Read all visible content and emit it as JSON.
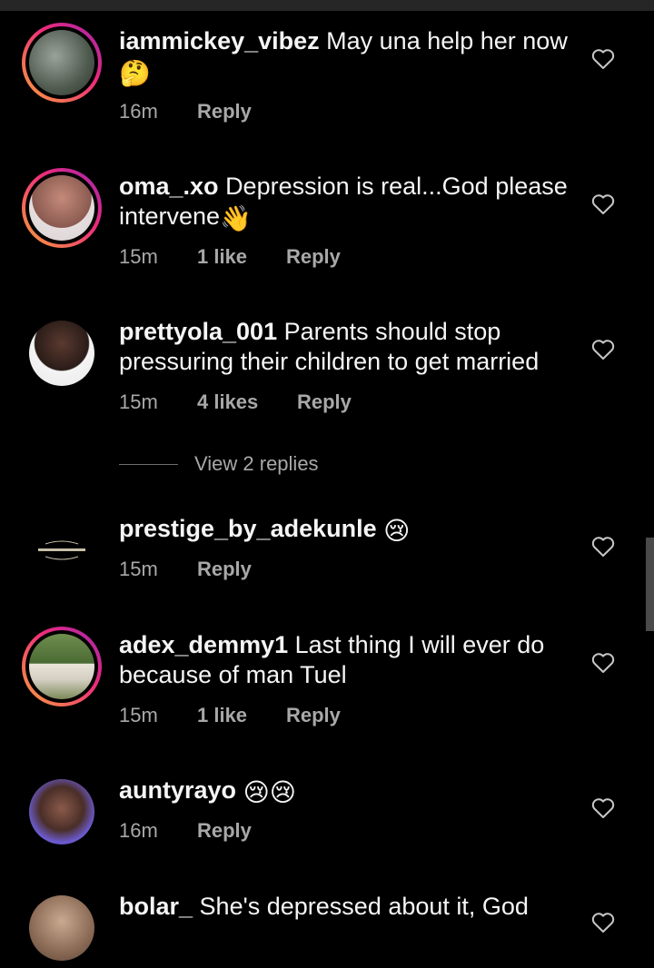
{
  "comments": [
    {
      "username": "iammickey_vibez",
      "text": "May una help her now",
      "emoji": "🤔",
      "time": "16m",
      "likes": "",
      "reply": "Reply"
    },
    {
      "username": "oma_.xo",
      "text": "Depression is real...God please intervene",
      "emoji": "👋",
      "time": "15m",
      "likes": "1 like",
      "reply": "Reply"
    },
    {
      "username": "prettyola_001",
      "text": "Parents should stop pressuring their children to get married",
      "emoji": "",
      "time": "15m",
      "likes": "4 likes",
      "reply": "Reply",
      "view_replies": "View 2 replies"
    },
    {
      "username": "prestige_by_adekunle",
      "text": "",
      "emoji": "😢",
      "time": "15m",
      "likes": "",
      "reply": "Reply"
    },
    {
      "username": "adex_demmy1",
      "text": "Last thing I will ever do because of man Tuel",
      "emoji": "",
      "time": "15m",
      "likes": "1 like",
      "reply": "Reply"
    },
    {
      "username": "auntyrayo",
      "text": "",
      "emoji": "😢😢",
      "time": "16m",
      "likes": "",
      "reply": "Reply"
    },
    {
      "username": "bolar_",
      "text": "She's depressed about it, God",
      "emoji": "",
      "time": "",
      "likes": "",
      "reply": ""
    }
  ],
  "icons": {
    "like": "heart-outline-icon"
  },
  "colors": {
    "background": "#000000",
    "text": "#f5f5f5",
    "muted": "#a8a8a8",
    "story_ring_start": "#f9a23b",
    "story_ring_end": "#9c27b0"
  }
}
